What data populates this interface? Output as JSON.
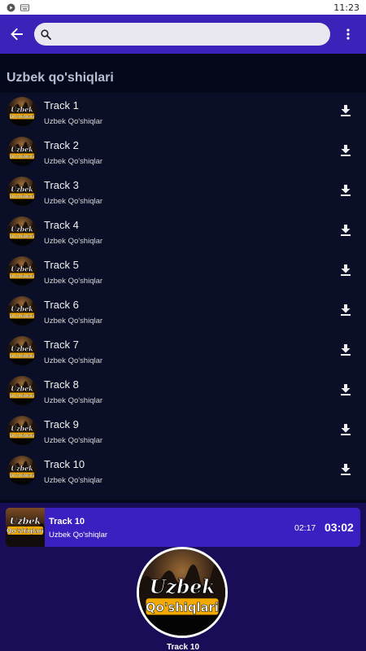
{
  "status": {
    "time": "11:23"
  },
  "toolbar": {
    "search_value": "",
    "search_placeholder": ""
  },
  "section": {
    "title": "Uzbek qo'shiqlari"
  },
  "logo_text": {
    "line1": "Uzbek",
    "line2": "Qo'shiqlari"
  },
  "tracks": [
    {
      "title": "Track 1",
      "artist": "Uzbek Qo'shiqlar"
    },
    {
      "title": "Track 2",
      "artist": "Uzbek Qo'shiqlar"
    },
    {
      "title": "Track 3",
      "artist": "Uzbek Qo'shiqlar"
    },
    {
      "title": "Track 4",
      "artist": "Uzbek Qo'shiqlar"
    },
    {
      "title": "Track 5",
      "artist": "Uzbek Qo'shiqlar"
    },
    {
      "title": "Track 6",
      "artist": "Uzbek Qo'shiqlar"
    },
    {
      "title": "Track 7",
      "artist": "Uzbek Qo'shiqlar"
    },
    {
      "title": "Track 8",
      "artist": "Uzbek Qo'shiqlar"
    },
    {
      "title": "Track 9",
      "artist": "Uzbek Qo'shiqlar"
    },
    {
      "title": "Track 10",
      "artist": "Uzbek Qo'shiqlar"
    }
  ],
  "player": {
    "title": "Track 10",
    "artist": "Uzbek Qo'shiqlar",
    "elapsed": "02:17",
    "duration": "03:02",
    "now_playing_title": "Track 10"
  },
  "icons": {
    "back": "arrow-back-icon",
    "search": "search-icon",
    "overflow": "more-vert-icon",
    "download": "download-icon"
  },
  "colors": {
    "accent": "#3b22b8",
    "list_background": "#0a0e26",
    "player_background": "#1a0d57",
    "logo_yellow": "#f2a900"
  }
}
